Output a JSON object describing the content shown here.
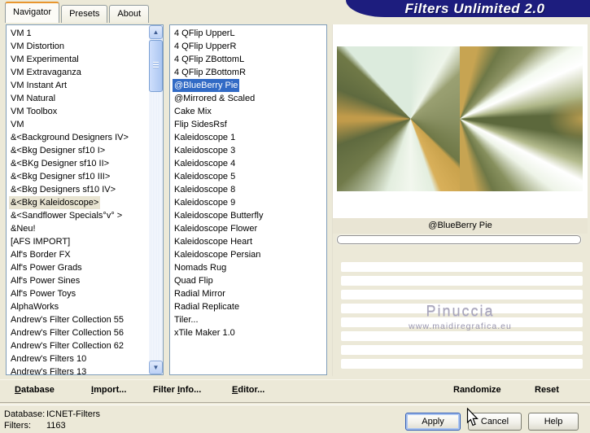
{
  "window": {
    "title": "Filters Unlimited 2.0"
  },
  "tabs": [
    {
      "label": "Navigator",
      "active": true
    },
    {
      "label": "Presets",
      "active": false
    },
    {
      "label": "About",
      "active": false
    }
  ],
  "category_list": {
    "selected": "&<Bkg Kaleidoscope>",
    "items": [
      "VM 1",
      "VM Distortion",
      "VM Experimental",
      "VM Extravaganza",
      "VM Instant Art",
      "VM Natural",
      "VM Toolbox",
      "VM",
      "&<Background Designers IV>",
      "&<Bkg Designer sf10 I>",
      "&<BKg Designer sf10 II>",
      "&<Bkg Designer sf10 III>",
      "&<Bkg Designers sf10 IV>",
      "&<Bkg Kaleidoscope>",
      "&<Sandflower Specials°v° >",
      "&Neu!",
      "[AFS IMPORT]",
      "Alf's Border FX",
      "Alf's Power Grads",
      "Alf's Power Sines",
      "Alf's Power Toys",
      "AlphaWorks",
      "Andrew's Filter Collection 55",
      "Andrew's Filter Collection 56",
      "Andrew's Filter Collection 62",
      "Andrew's Filters 10",
      "Andrew's Filters 13"
    ]
  },
  "filter_list": {
    "selected": "@BlueBerry Pie",
    "items": [
      "4 QFlip UpperL",
      "4 QFlip UpperR",
      "4 QFlip ZBottomL",
      "4 QFlip ZBottomR",
      "@BlueBerry Pie",
      "@Mirrored & Scaled",
      "Cake Mix",
      "Flip SidesRsf",
      "Kaleidoscope 1",
      "Kaleidoscope 3",
      "Kaleidoscope 4",
      "Kaleidoscope 5",
      "Kaleidoscope 8",
      "Kaleidoscope 9",
      "Kaleidoscope Butterfly",
      "Kaleidoscope Flower",
      "Kaleidoscope Heart",
      "Kaleidoscope Persian",
      "Nomads Rug",
      "Quad Flip",
      "Radial Mirror",
      "Radial Replicate",
      "Tiler...",
      "xTile Maker 1.0"
    ]
  },
  "preview": {
    "filter_name": "@BlueBerry Pie",
    "progress_percent": 0,
    "slider_rows": 8,
    "watermark_title": "Pinuccia",
    "watermark_url": "www.maidiregrafica.eu"
  },
  "toolbar": {
    "database": {
      "label": "Database",
      "accel": 0
    },
    "import": {
      "label": "Import...",
      "accel": 0
    },
    "filter_info": {
      "label": "Filter Info...",
      "accel": 7
    },
    "editor": {
      "label": "Editor...",
      "accel": 0
    },
    "randomize": {
      "label": "Randomize",
      "accel": -1
    },
    "reset": {
      "label": "Reset",
      "accel": -1
    }
  },
  "status": {
    "database_label": "Database:",
    "database_value": "ICNET-Filters",
    "filters_label": "Filters:",
    "filters_value": "1163"
  },
  "actions": {
    "apply": "Apply",
    "cancel": "Cancel",
    "help": "Help"
  },
  "colors": {
    "dialog_bg": "#ece9d8",
    "banner_navy": "#1d1d7e",
    "active_tab_orange": "#e8962e",
    "selection_blue": "#316ac5",
    "inactive_selection": "#e8e4d2"
  }
}
